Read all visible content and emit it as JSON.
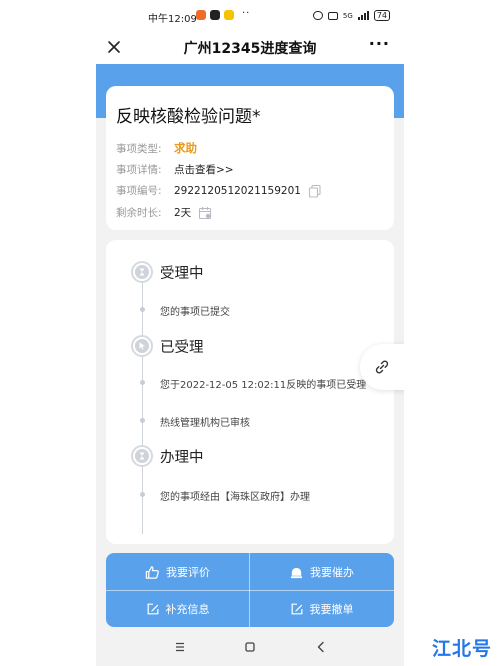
{
  "status_bar": {
    "time": "中午12:09",
    "dots": "··",
    "network": "5G",
    "battery": "74"
  },
  "nav": {
    "title": "广州12345进度查询",
    "more": "···"
  },
  "info": {
    "title": "反映核酸检验问题*",
    "rows": [
      {
        "label": "事项类型:",
        "value": "求助"
      },
      {
        "label": "事项详情:",
        "value": "点击查看>>"
      },
      {
        "label": "事项编号:",
        "value": "2922120512021159201"
      },
      {
        "label": "剩余时长:",
        "value": "2天"
      }
    ]
  },
  "timeline": {
    "steps": [
      {
        "heading": "受理中",
        "items": [
          "您的事项已提交"
        ]
      },
      {
        "heading": "已受理",
        "items": [
          "您于2022-12-05 12:02:11反映的事项已受理",
          "热线管理机构已审核"
        ]
      },
      {
        "heading": "办理中",
        "items": [
          "您的事项经由【海珠区政府】办理"
        ]
      }
    ]
  },
  "actions": {
    "rate": "我要评价",
    "urge": "我要催办",
    "supplement": "补充信息",
    "withdraw": "我要撤单"
  },
  "watermark": "江北号",
  "colors": {
    "accent_blue": "#5aa1ec",
    "accent_orange": "#e89b1c",
    "watermark_blue": "#2477e8"
  }
}
